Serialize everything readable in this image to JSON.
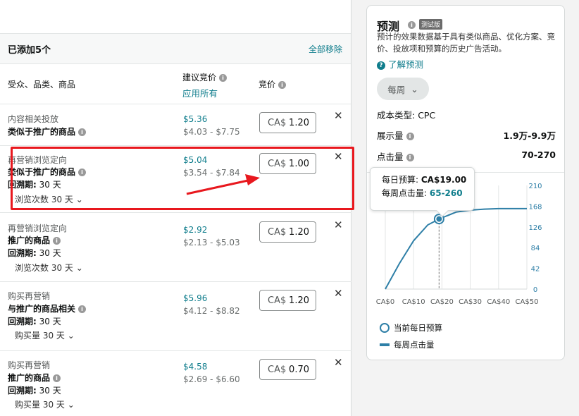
{
  "left_panel": {
    "header": {
      "title": "已添加5个",
      "remove_all": "全部移除"
    },
    "columns": {
      "target": "受众、品类、商品",
      "suggested": "建议竞价",
      "apply_all": "应用所有",
      "bid": "竞价"
    },
    "rows": [
      {
        "line1": "内容相关投放",
        "line2": "类似于推广的商品",
        "suggested": "$5.36",
        "range": "$4.03 - $7.75",
        "currency": "CA$",
        "bid": "1.20"
      },
      {
        "line1": "再营销浏览定向",
        "line2": "类似于推广的商品",
        "lookback_label": "回溯期:",
        "lookback_value": "30 天",
        "dropdown": "浏览次数 30 天",
        "suggested": "$5.04",
        "range": "$3.54 - $7.84",
        "currency": "CA$",
        "bid": "1.00"
      },
      {
        "line1": "再营销浏览定向",
        "line2": "推广的商品",
        "lookback_label": "回溯期:",
        "lookback_value": "30 天",
        "dropdown": "浏览次数 30 天",
        "suggested": "$2.92",
        "range": "$2.13 - $5.03",
        "currency": "CA$",
        "bid": "1.20"
      },
      {
        "line1": "购买再营销",
        "line2": "与推广的商品相关",
        "lookback_label": "回溯期:",
        "lookback_value": "30 天",
        "dropdown": "购买量 30 天",
        "suggested": "$5.96",
        "range": "$4.12 - $8.82",
        "currency": "CA$",
        "bid": "1.20"
      },
      {
        "line1": "购买再营销",
        "line2": "推广的商品",
        "lookback_label": "回溯期:",
        "lookback_value": "30 天",
        "dropdown": "购买量 30 天",
        "suggested": "$4.58",
        "range": "$2.69 - $6.60",
        "currency": "CA$",
        "bid": "0.70"
      }
    ],
    "close_icon": "✕"
  },
  "forecast": {
    "title": "预测",
    "beta": "测试版",
    "description": "预计的效果数据基于具有类似商品、优化方案、竞价、投放项和预算的历史广告活动。",
    "learn_more": "了解预测",
    "period": "每周",
    "cost_type_label": "成本类型:",
    "cost_type_value": "CPC",
    "impressions_label": "展示量",
    "impressions_value": "1.9万-9.9万",
    "clicks_label": "点击量",
    "clicks_value": "70-270",
    "tooltip": {
      "budget_label": "每日预算:",
      "budget_value": "CA$19.00",
      "clicks_label": "每周点击量:",
      "clicks_value": "65-260"
    },
    "legend": {
      "current_budget": "当前每日预算",
      "weekly_clicks": "每周点击量"
    },
    "colors": {
      "accent": "#0f7d8c",
      "line": "#2e7fa7",
      "highlight": "#e8181e"
    }
  },
  "chart_data": {
    "type": "line",
    "x_ticks": [
      "CA$0",
      "CA$10",
      "CA$20",
      "CA$30",
      "CA$40",
      "CA$50"
    ],
    "y_ticks": [
      "0",
      "42",
      "84",
      "126",
      "168",
      "210"
    ],
    "xlim": [
      0,
      50
    ],
    "ylim": [
      0,
      210
    ],
    "series": [
      {
        "x": [
          0,
          5,
          10,
          15,
          19,
          25,
          30,
          35,
          40,
          45,
          50
        ],
        "y": [
          0,
          52,
          98,
          130,
          142,
          156,
          160,
          162,
          163,
          163,
          163
        ]
      }
    ],
    "marker": {
      "x": 19,
      "y": 142
    },
    "grid": true
  }
}
